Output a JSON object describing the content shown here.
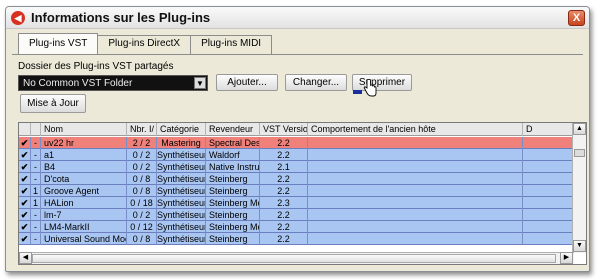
{
  "window": {
    "title": "Informations sur les Plug-ins",
    "close_label": "X"
  },
  "tabs": [
    {
      "label": "Plug-ins VST",
      "active": true
    },
    {
      "label": "Plug-ins DirectX",
      "active": false
    },
    {
      "label": "Plug-ins MIDI",
      "active": false
    }
  ],
  "folders": {
    "label": "Dossier des Plug-ins VST partagés",
    "selected": "No Common VST Folder",
    "add": "Ajouter...",
    "change": "Changer...",
    "remove": "Supprimer"
  },
  "update_label": "Mise à Jour",
  "table": {
    "columns": [
      "",
      "",
      "Nom",
      "Nbr. I/",
      "Catégorie",
      "Revendeur",
      "VST Version",
      "Comportement de l'ancien hôte",
      "D"
    ],
    "rows": [
      {
        "check": "✔",
        "num": "-",
        "name": "uv22 hr",
        "io": "2 / 2",
        "category": "Mastering",
        "vendor": "Spectral Desig",
        "version": "2.2",
        "selected": true
      },
      {
        "check": "✔",
        "num": "-",
        "name": "a1",
        "io": "0 / 2",
        "category": "Synthétiseur",
        "vendor": "Waldorf",
        "version": "2.2",
        "selected": false
      },
      {
        "check": "✔",
        "num": "-",
        "name": "B4",
        "io": "0 / 2",
        "category": "Synthétiseur",
        "vendor": "Native Instrum",
        "version": "2.1",
        "selected": false
      },
      {
        "check": "✔",
        "num": "-",
        "name": "D'cota",
        "io": "0 / 8",
        "category": "Synthétiseur",
        "vendor": "Steinberg",
        "version": "2.2",
        "selected": false
      },
      {
        "check": "✔",
        "num": "1",
        "name": "Groove Agent",
        "io": "0 / 8",
        "category": "Synthétiseur",
        "vendor": "Steinberg",
        "version": "2.2",
        "selected": false
      },
      {
        "check": "✔",
        "num": "1",
        "name": "HALion",
        "io": "0 / 18",
        "category": "Synthétiseur",
        "vendor": "Steinberg Mec",
        "version": "2.3",
        "selected": false
      },
      {
        "check": "✔",
        "num": "-",
        "name": "lm-7",
        "io": "0 / 2",
        "category": "Synthétiseur",
        "vendor": "Steinberg",
        "version": "2.2",
        "selected": false
      },
      {
        "check": "✔",
        "num": "-",
        "name": "LM4-MarkII",
        "io": "0 / 12",
        "category": "Synthétiseur",
        "vendor": "Steinberg Mec",
        "version": "2.2",
        "selected": false
      },
      {
        "check": "✔",
        "num": "-",
        "name": "Universal Sound Module",
        "io": "0 / 8",
        "category": "Synthétiseur",
        "vendor": "Steinberg",
        "version": "2.2",
        "selected": false
      }
    ]
  },
  "scroll_arrows": {
    "up": "▲",
    "down": "▼",
    "left": "◀",
    "right": "▶"
  },
  "colors": {
    "selected_row": "#f0807a",
    "row": "#a9c6f2",
    "accent": "#d83020"
  }
}
